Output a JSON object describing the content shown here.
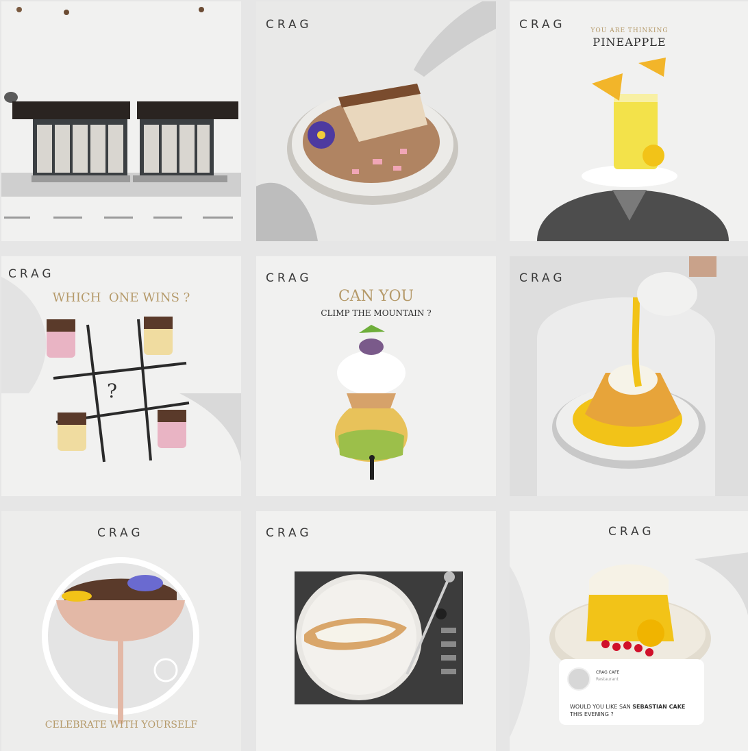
{
  "brand": "CRAG",
  "tiles": {
    "storefront": {
      "name": "storefront"
    },
    "tiramisu": {
      "logo": "CRAG"
    },
    "pineapple": {
      "logo": "CRAG",
      "kicker": "YOU ARE THINKING",
      "title": "PINEAPPLE"
    },
    "tictactoe": {
      "logo": "CRAG",
      "title": "WHICH  ONE WINS ?",
      "mark": "?"
    },
    "mountain": {
      "logo": "CRAG",
      "title": "CAN YOU",
      "subtitle": "CLIMP THE MOUNTAIN ?"
    },
    "pour": {
      "logo": "CRAG"
    },
    "celebrate": {
      "logo": "CRAG",
      "caption": "CELEBRATE WITH YOURSELF"
    },
    "turntable": {
      "logo": "CRAG"
    },
    "sebastian": {
      "logo": "CRAG",
      "card_name": "CRAG CAFE",
      "card_sub": "Restaurant",
      "card_msg_1": "WOULD YOU LIKE SAN ",
      "card_msg_bold": "SEBASTIAN CAKE",
      "card_msg_2": "THIS EVENING ?"
    }
  },
  "colors": {
    "paper": "#f3f3f2",
    "gold": "#b59a6a",
    "ink": "#2e2e2e",
    "yellow": "#f2c318"
  }
}
